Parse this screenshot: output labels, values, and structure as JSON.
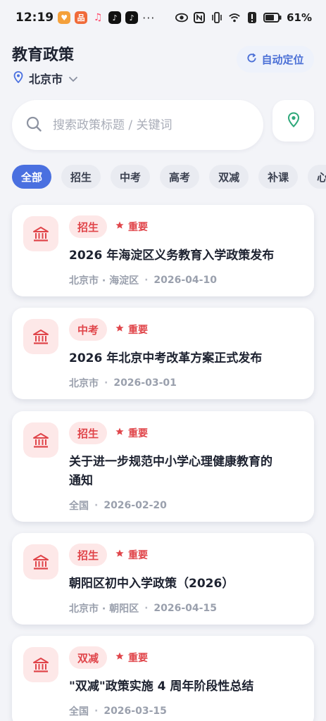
{
  "status_bar": {
    "time": "12:19",
    "apps": [
      {
        "name": "app-heart-icon",
        "color": "#f4a03b",
        "glyph": "♥"
      },
      {
        "name": "app-grid-icon",
        "color": "#f06b3a",
        "glyph": "品"
      },
      {
        "name": "music-note-icon",
        "color": "#ff4d6d",
        "glyph": "♫"
      },
      {
        "name": "tiktok-icon",
        "color": "#111111",
        "glyph": "♪"
      },
      {
        "name": "tiktok-icon-2",
        "color": "#111111",
        "glyph": "♪"
      }
    ],
    "more": "···",
    "battery": "61%"
  },
  "header": {
    "title": "教育政策",
    "city": "北京市",
    "auto_locate": "自动定位"
  },
  "search": {
    "placeholder": "搜索政策标题 / 关键词"
  },
  "tabs": [
    "全部",
    "招生",
    "中考",
    "高考",
    "双减",
    "补课",
    "心"
  ],
  "active_tab": 0,
  "colors": {
    "accent": "#4a70e0",
    "badge_red": "#e0454a",
    "badge_bg": "#fde7e7",
    "location_green": "#2ea87a"
  },
  "important_label": "重要",
  "cards": [
    {
      "category": "招生",
      "title_lines": [
        "2026 年海淀区义务教育入学政策发布"
      ],
      "region": "北京市 · 海淀区",
      "date": "2026-04-10"
    },
    {
      "category": "中考",
      "title_lines": [
        "2026 年北京中考改革方案正式发布"
      ],
      "region": "北京市",
      "date": "2026-03-01"
    },
    {
      "category": "招生",
      "title_lines": [
        "关于进一步规范中小学心理健康教育的",
        "通知"
      ],
      "region": "全国",
      "date": "2026-02-20"
    },
    {
      "category": "招生",
      "title_lines": [
        "朝阳区初中入学政策（2026）"
      ],
      "region": "北京市 · 朝阳区",
      "date": "2026-04-15"
    },
    {
      "category": "双减",
      "title_lines": [
        "\"双减\"政策实施 4 周年阶段性总结"
      ],
      "region": "全国",
      "date": "2026-03-15"
    }
  ]
}
